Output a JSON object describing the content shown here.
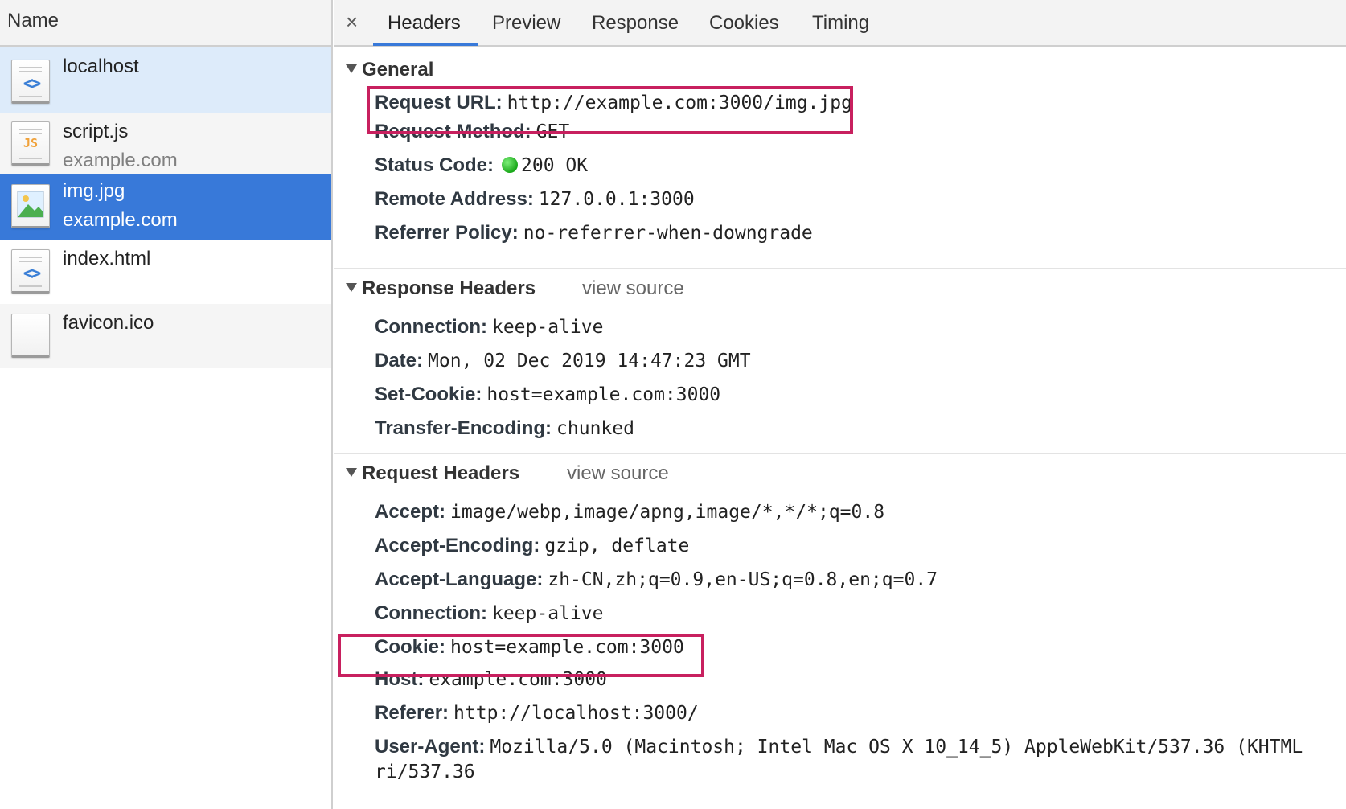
{
  "requests_panel": {
    "header": "Name",
    "items": [
      {
        "name": "localhost",
        "domain": "",
        "type": "document-icon"
      },
      {
        "name": "script.js",
        "domain": "example.com",
        "type": "script-icon",
        "icon_text": "JS"
      },
      {
        "name": "img.jpg",
        "domain": "example.com",
        "type": "image-icon"
      },
      {
        "name": "index.html",
        "domain": "",
        "type": "document-icon"
      },
      {
        "name": "favicon.ico",
        "domain": "",
        "type": "blank-file-icon"
      }
    ],
    "selected_index": 2
  },
  "tabs": {
    "close": "×",
    "items": [
      "Headers",
      "Preview",
      "Response",
      "Cookies",
      "Timing"
    ],
    "active": "Headers"
  },
  "general": {
    "title": "General",
    "rows": [
      {
        "key": "Request URL:",
        "value": "http://example.com:3000/img.jpg"
      },
      {
        "key": "Request Method:",
        "value": "GET"
      },
      {
        "key": "Status Code:",
        "value": "200 OK"
      },
      {
        "key": "Remote Address:",
        "value": "127.0.0.1:3000"
      },
      {
        "key": "Referrer Policy:",
        "value": "no-referrer-when-downgrade"
      }
    ]
  },
  "response_headers": {
    "title": "Response Headers",
    "view_source": "view source",
    "rows": [
      {
        "key": "Connection:",
        "value": "keep-alive"
      },
      {
        "key": "Date:",
        "value": "Mon, 02 Dec 2019 14:47:23 GMT"
      },
      {
        "key": "Set-Cookie:",
        "value": "host=example.com:3000"
      },
      {
        "key": "Transfer-Encoding:",
        "value": "chunked"
      }
    ]
  },
  "request_headers": {
    "title": "Request Headers",
    "view_source": "view source",
    "rows": [
      {
        "key": "Accept:",
        "value": "image/webp,image/apng,image/*,*/*;q=0.8"
      },
      {
        "key": "Accept-Encoding:",
        "value": "gzip, deflate"
      },
      {
        "key": "Accept-Language:",
        "value": "zh-CN,zh;q=0.9,en-US;q=0.8,en;q=0.7"
      },
      {
        "key": "Connection:",
        "value": "keep-alive"
      },
      {
        "key": "Cookie:",
        "value": "host=example.com:3000"
      },
      {
        "key": "Host:",
        "value": "example.com:3000"
      },
      {
        "key": "Referer:",
        "value": "http://localhost:3000/"
      },
      {
        "key": "User-Agent:",
        "value": "Mozilla/5.0 (Macintosh; Intel Mac OS X 10_14_5) AppleWebKit/537.36 (KHTML"
      }
    ],
    "user_agent_wrap": "ri/537.36"
  },
  "colors": {
    "selected_row": "#3879d9",
    "highlight_box": "#c8205f",
    "status_ok": "#1aa81a"
  }
}
